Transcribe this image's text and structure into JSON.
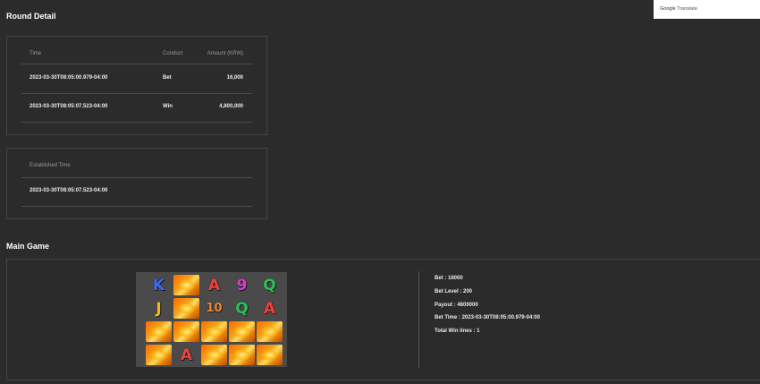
{
  "round_detail": {
    "title": "Round Detail",
    "headers": {
      "time": "Time",
      "conduct": "Conduct",
      "amount": "Amount (KRW)"
    },
    "rows": [
      {
        "time": "2023-03-30T08:05:00.979-04:00",
        "conduct": "Bet",
        "amount": "16,000"
      },
      {
        "time": "2023-03-30T08:05:07.523-04:00",
        "conduct": "Win",
        "amount": "4,800,000"
      }
    ]
  },
  "established": {
    "header": "Established Time",
    "value": "2023-03-30T08:05:07.523-04:00"
  },
  "main_game": {
    "title": "Main Game",
    "reels": [
      [
        "K",
        "wild",
        "A",
        "9",
        "Q"
      ],
      [
        "J",
        "wild",
        "10",
        "Q",
        "A"
      ],
      [
        "wild",
        "wild",
        "wild",
        "wild",
        "wild"
      ],
      [
        "wild",
        "A",
        "wild",
        "wild",
        "wild"
      ]
    ],
    "symbol_colors": {
      "K": "#3d6bf0",
      "A": "#f0423c",
      "9": "#d63fd0",
      "Q": "#2cc25a",
      "J": "#f2b620",
      "10": "#f08a3c"
    },
    "info": [
      "Bet : 16000",
      "Bet Level : 200",
      "Payout : 4800000",
      "Bet Time : 2023-03-30T08:05:00.979-04:00",
      "Total Win lines : 1"
    ]
  },
  "translate": {
    "brand": "Google",
    "label": "Translate"
  }
}
